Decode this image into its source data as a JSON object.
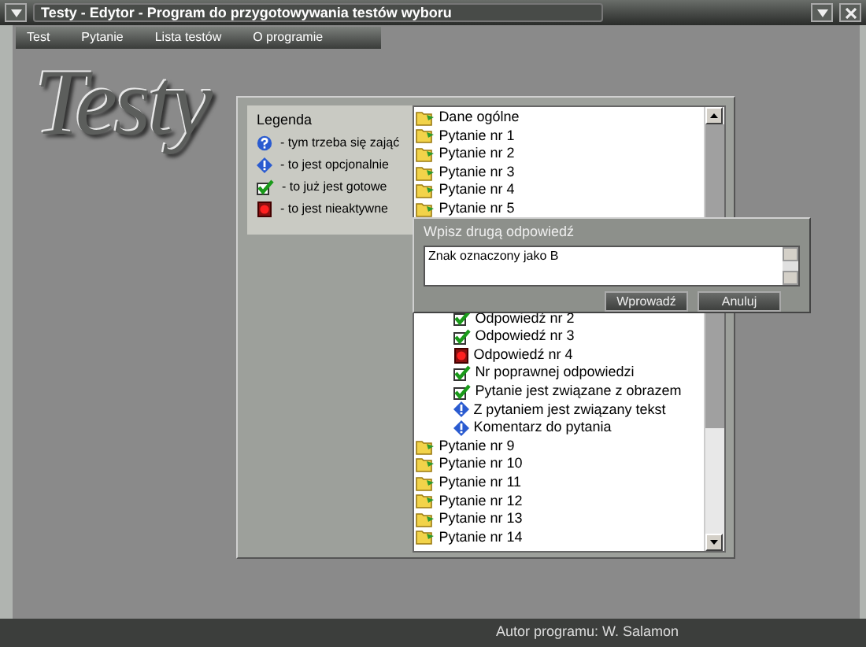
{
  "window": {
    "title": "Testy - Edytor - Program do przygotowywania testów wyboru"
  },
  "menu": [
    "Test",
    "Pytanie",
    "Lista testów",
    "O programie"
  ],
  "logo": "Testy",
  "legend": {
    "title": "Legenda",
    "items": [
      {
        "kind": "required",
        "text": "- tym trzeba się zająć"
      },
      {
        "kind": "optional",
        "text": "- to jest opcjonalnie"
      },
      {
        "kind": "done",
        "text": "- to już jest gotowe"
      },
      {
        "kind": "inactive",
        "text": "- to jest nieaktywne"
      }
    ]
  },
  "tree": {
    "items": [
      {
        "kind": "folder",
        "label": "Dane ogólne"
      },
      {
        "kind": "folder",
        "label": "Pytanie nr 1"
      },
      {
        "kind": "folder",
        "label": "Pytanie nr 2"
      },
      {
        "kind": "folder",
        "label": "Pytanie nr 3"
      },
      {
        "kind": "folder",
        "label": "Pytanie nr 4"
      },
      {
        "kind": "folder",
        "label": "Pytanie nr 5"
      },
      {
        "kind": "group",
        "children": [
          {
            "kind": "done",
            "label": "Odpowiedź nr 2"
          },
          {
            "kind": "done",
            "label": "Odpowiedź nr 3"
          },
          {
            "kind": "inactive",
            "label": "Odpowiedź nr 4"
          },
          {
            "kind": "done",
            "label": "Nr poprawnej odpowiedzi"
          },
          {
            "kind": "done",
            "label": "Pytanie jest związane z obrazem"
          },
          {
            "kind": "optional",
            "label": "Z pytaniem jest związany tekst"
          },
          {
            "kind": "optional",
            "label": "Komentarz do pytania"
          }
        ]
      },
      {
        "kind": "folder",
        "label": "Pytanie nr 9"
      },
      {
        "kind": "folder",
        "label": "Pytanie nr 10"
      },
      {
        "kind": "folder",
        "label": "Pytanie nr 11"
      },
      {
        "kind": "folder",
        "label": "Pytanie nr 12"
      },
      {
        "kind": "folder",
        "label": "Pytanie nr 13"
      },
      {
        "kind": "folder",
        "label": "Pytanie nr 14"
      }
    ]
  },
  "dialog": {
    "title": "Wpisz drugą odpowiedź",
    "value": "Znak oznaczony jako B",
    "buttons": [
      "Wprowadź",
      "Anuluj"
    ]
  },
  "status_bar": "Autor programu: W. Salamon"
}
